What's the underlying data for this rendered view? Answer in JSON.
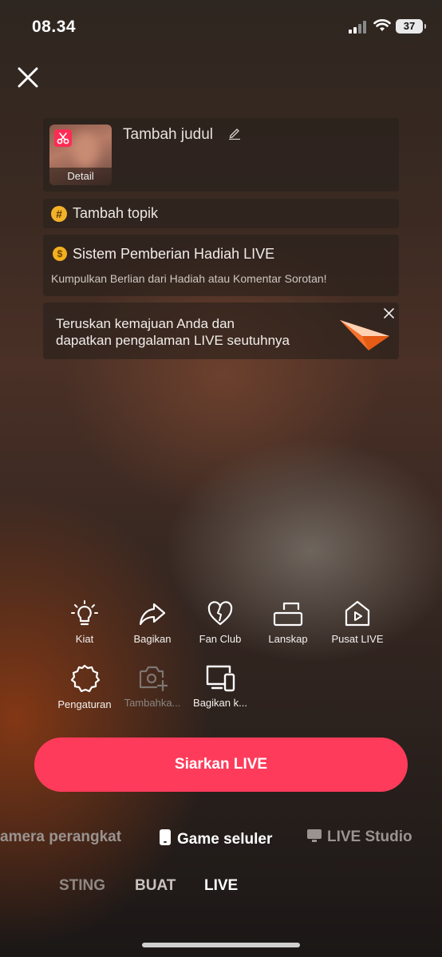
{
  "status_bar": {
    "time": "08.34",
    "battery": "37"
  },
  "setup": {
    "title_placeholder": "Tambah judul",
    "thumb_label": "Detail",
    "topic_label": "Tambah topik",
    "gift_title": "Sistem Pemberian Hadiah LIVE",
    "gift_subtitle": "Kumpulkan Berlian dari Hadiah atau Komentar Sorotan!",
    "promo_line1": "Teruskan kemajuan Anda dan",
    "promo_line2": "dapatkan pengalaman LIVE seutuhnya"
  },
  "tools": [
    {
      "label": "Kiat",
      "icon": "lightbulb-icon"
    },
    {
      "label": "Bagikan",
      "icon": "share-arrow-icon"
    },
    {
      "label": "Fan Club",
      "icon": "heart-icon"
    },
    {
      "label": "Lanskap",
      "icon": "rotate-landscape-icon"
    },
    {
      "label": "Pusat LIVE",
      "icon": "live-center-icon"
    },
    {
      "label": "Pengaturan",
      "icon": "gear-icon"
    },
    {
      "label": "Tambahka...",
      "icon": "add-camera-icon",
      "disabled": true
    },
    {
      "label": "Bagikan k...",
      "icon": "screen-devices-icon"
    }
  ],
  "go_live_label": "Siarkan LIVE",
  "source_modes": [
    {
      "label": "amera perangkat",
      "active": false
    },
    {
      "label": "Game seluler",
      "active": true,
      "icon": "phone-icon"
    },
    {
      "label": "LIVE Studio",
      "active": false,
      "icon": "monitor-icon"
    }
  ],
  "bottom_tabs": [
    {
      "label": "STING",
      "active": false
    },
    {
      "label": "BUAT",
      "active": false
    },
    {
      "label": "LIVE",
      "active": true
    }
  ],
  "colors": {
    "primary": "#fe3b5b",
    "accent_coin": "#f2b01e"
  }
}
